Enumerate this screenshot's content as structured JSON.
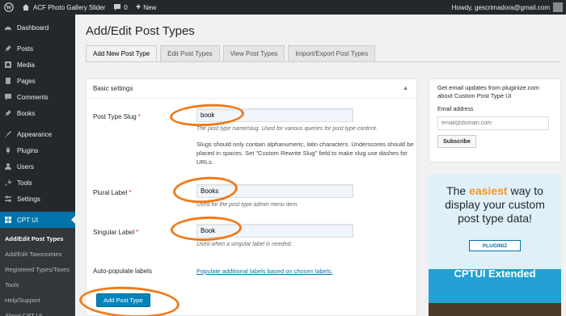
{
  "admin_bar": {
    "site_name": "ACF Photo Gallery Slider",
    "comments_count": "0",
    "new_label": "New",
    "howdy": "Howdy, gescrimadora@gmail.com"
  },
  "sidebar": {
    "items": [
      {
        "label": "Dashboard",
        "icon": "dashboard-icon"
      },
      {
        "label": "Posts",
        "icon": "pin-icon"
      },
      {
        "label": "Media",
        "icon": "media-icon"
      },
      {
        "label": "Pages",
        "icon": "page-icon"
      },
      {
        "label": "Comments",
        "icon": "comment-icon"
      },
      {
        "label": "Books",
        "icon": "pin-icon"
      },
      {
        "label": "Appearance",
        "icon": "brush-icon"
      },
      {
        "label": "Plugins",
        "icon": "plug-icon"
      },
      {
        "label": "Users",
        "icon": "user-icon"
      },
      {
        "label": "Tools",
        "icon": "wrench-icon"
      },
      {
        "label": "Settings",
        "icon": "settings-icon"
      },
      {
        "label": "CPT UI",
        "icon": "grid-icon"
      }
    ],
    "submenu": [
      "Add/Edit Post Types",
      "Add/Edit Taxonomies",
      "Registered Types/Taxes",
      "Tools",
      "Help/Support",
      "About CPT UI"
    ]
  },
  "page": {
    "title": "Add/Edit Post Types",
    "tabs": [
      "Add New Post Type",
      "Edit Post Types",
      "View Post Types",
      "Import/Export Post Types"
    ]
  },
  "settings": {
    "heading": "Basic settings",
    "slug_label": "Post Type Slug",
    "slug_value": "book",
    "slug_desc": "The post type name/slug. Used for various queries for post type content.",
    "slug_note": "Slugs should only contain alphanumeric, latin characters. Underscores should be placed in spaces. Set \"Custom Rewrite Slug\" field to make slug use dashes for URLs.",
    "plural_label": "Plural Label",
    "plural_value": "Books",
    "plural_desc": "Used for the post type admin menu item.",
    "singular_label": "Singular Label",
    "singular_value": "Book",
    "singular_desc": "Used when a singular label is needed.",
    "autopop_label": "Auto-populate labels",
    "autopop_link": "Populate additional labels based on chosen labels.",
    "required_mark": "*",
    "submit_label": "Add Post Type"
  },
  "newsletter": {
    "title": "Get email updates from pluginize.com about Custom Post Type UI",
    "email_label": "Email address",
    "email_placeholder": "email@domain.com",
    "subscribe_label": "Subscribe"
  },
  "ad": {
    "line1_prefix": "The",
    "line1_accent": "easiest",
    "line1_suffix": "way to",
    "line2": "display your custom",
    "line3": "post type data!",
    "badge": "PLUGINIZ",
    "cta": "CPTUI Extended"
  },
  "colors": {
    "admin_dark": "#23282d",
    "wp_blue": "#0073aa",
    "annotation_orange": "#f07a1a",
    "ad_accent": "#f89820"
  }
}
